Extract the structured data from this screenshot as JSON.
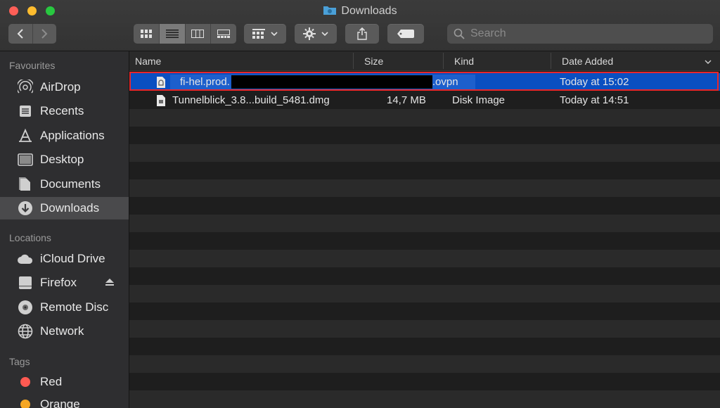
{
  "window": {
    "title": "Downloads"
  },
  "search": {
    "placeholder": "Search"
  },
  "sidebar": {
    "favourites_header": "Favourites",
    "favourites": [
      {
        "label": "AirDrop",
        "icon": "airdrop-icon"
      },
      {
        "label": "Recents",
        "icon": "recents-icon"
      },
      {
        "label": "Applications",
        "icon": "applications-icon"
      },
      {
        "label": "Desktop",
        "icon": "desktop-icon"
      },
      {
        "label": "Documents",
        "icon": "documents-icon"
      },
      {
        "label": "Downloads",
        "icon": "downloads-icon",
        "selected": true
      }
    ],
    "locations_header": "Locations",
    "locations": [
      {
        "label": "iCloud Drive",
        "icon": "cloud-icon"
      },
      {
        "label": "Firefox",
        "icon": "drive-icon",
        "ejectable": true
      },
      {
        "label": "Remote Disc",
        "icon": "disc-icon"
      },
      {
        "label": "Network",
        "icon": "network-icon"
      }
    ],
    "tags_header": "Tags",
    "tags": [
      {
        "label": "Red",
        "color": "#ff5a52"
      },
      {
        "label": "Orange",
        "color": "#f5a623"
      }
    ]
  },
  "list": {
    "columns": {
      "name": "Name",
      "size": "Size",
      "kind": "Kind",
      "date_added": "Date Added"
    },
    "files": [
      {
        "name_prefix": "fi-hel.prod.",
        "name_suffix": ".ovpn",
        "size": "",
        "kind": "",
        "date_added": "Today at 15:02",
        "selected": true
      },
      {
        "name": "Tunnelblick_3.8...build_5481.dmg",
        "size": "14,7 MB",
        "kind": "Disk Image",
        "date_added": "Today at 14:51"
      }
    ]
  },
  "colors": {
    "selection": "#0a4fc1",
    "highlight_outline": "#e8262b"
  }
}
